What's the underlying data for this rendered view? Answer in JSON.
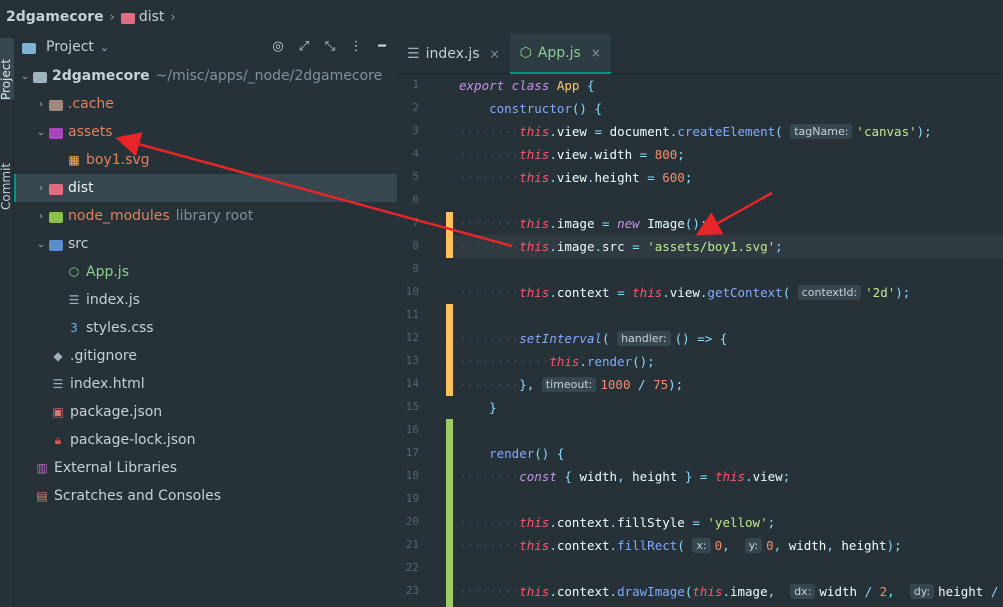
{
  "breadcrumb": {
    "project": "2dgamecore",
    "folder": "dist",
    "sep": "›"
  },
  "toolstrip": {
    "project_label": "Project",
    "commit_label": "Commit"
  },
  "panel": {
    "title": "Project",
    "chevron": "⌄"
  },
  "tree": [
    {
      "name": "2dgamecore",
      "hint": "~/misc/apps/_node/2dgamecore",
      "arrow": "⌄",
      "icon": "folder-icon",
      "indent": 0
    },
    {
      "name": ".cache",
      "arrow": "›",
      "icon": "folder-icon",
      "indent": 1
    },
    {
      "name": "assets",
      "arrow": "⌄",
      "icon": "folder-icon",
      "indent": 1
    },
    {
      "name": "boy1.svg",
      "arrow": "",
      "icon": "svg-file-icon",
      "indent": 2
    },
    {
      "name": "dist",
      "arrow": "›",
      "icon": "folder-icon",
      "indent": 1
    },
    {
      "name": "node_modules",
      "hint": "library root",
      "arrow": "›",
      "icon": "folder-icon",
      "indent": 1
    },
    {
      "name": "src",
      "arrow": "⌄",
      "icon": "folder-icon",
      "indent": 1
    },
    {
      "name": "App.js",
      "arrow": "",
      "icon": "js-file-icon",
      "indent": 2
    },
    {
      "name": "index.js",
      "arrow": "",
      "icon": "js-file-icon",
      "indent": 2
    },
    {
      "name": "styles.css",
      "arrow": "",
      "icon": "css-file-icon",
      "indent": 2
    },
    {
      "name": ".gitignore",
      "arrow": "",
      "icon": "git-file-icon",
      "indent": 1
    },
    {
      "name": "index.html",
      "arrow": "",
      "icon": "html-file-icon",
      "indent": 1
    },
    {
      "name": "package.json",
      "arrow": "",
      "icon": "json-file-icon",
      "indent": 1
    },
    {
      "name": "package-lock.json",
      "arrow": "",
      "icon": "lock-file-icon",
      "indent": 1
    },
    {
      "name": "External Libraries",
      "arrow": "",
      "icon": "library-icon",
      "indent": 0
    },
    {
      "name": "Scratches and Consoles",
      "arrow": "",
      "icon": "scratch-icon",
      "indent": 0
    }
  ],
  "tabs": [
    {
      "label": "index.js",
      "close": "×"
    },
    {
      "label": "App.js",
      "close": "×"
    }
  ],
  "code": {
    "line_numbers": [
      "1",
      "2",
      "3",
      "4",
      "5",
      "6",
      "7",
      "8",
      "9",
      "10",
      "11",
      "12",
      "13",
      "14",
      "15",
      "16",
      "17",
      "18",
      "19",
      "20",
      "21",
      "22",
      "23"
    ],
    "hints": {
      "tagName": "tagName:",
      "contextId": "contextId:",
      "handler": "handler:",
      "timeout": "timeout:",
      "x": "x:",
      "y": "y:",
      "dx": "dx:",
      "dy": "dy:"
    },
    "strings": {
      "canvas": "'canvas'",
      "src": "'assets/boy1.svg'",
      "ctx": "'2d'",
      "yellow": "'yellow'"
    },
    "numbers": {
      "w": "800",
      "h": "600",
      "t1": "1000",
      "t2": "75",
      "zero": "0",
      "two": "2"
    }
  },
  "colors": {
    "accent": "#009688",
    "annotation_arrow": "#e8262a",
    "modified_marker": "#ffc15e",
    "added_marker": "#9ccc65"
  }
}
